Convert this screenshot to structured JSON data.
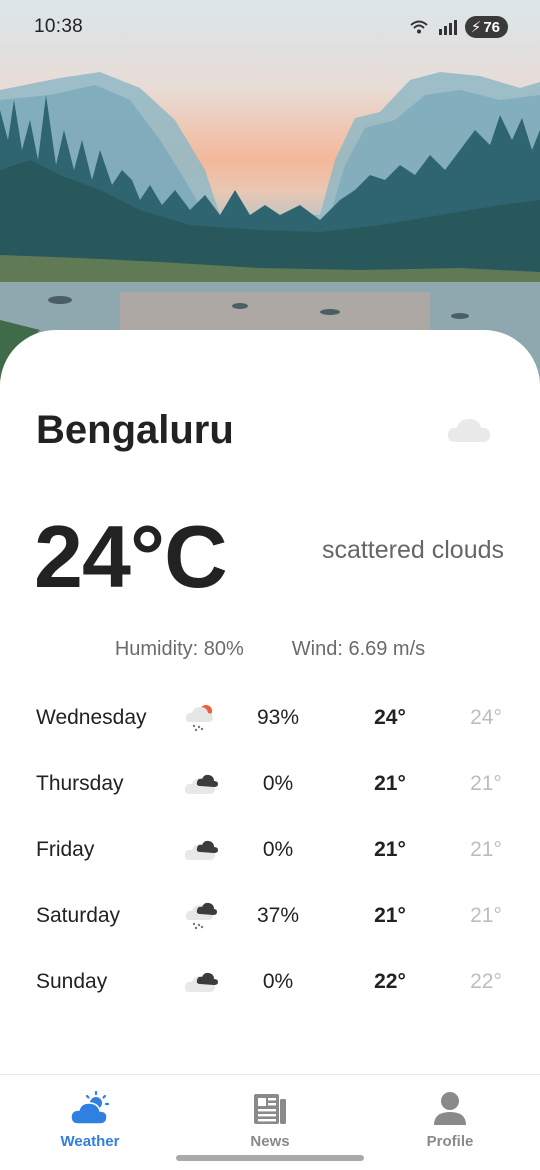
{
  "status_bar": {
    "time": "10:38",
    "battery": "76"
  },
  "weather": {
    "city": "Bengaluru",
    "header_icon": "cloud-icon",
    "temperature": "24°C",
    "description": "scattered clouds",
    "humidity": "Humidity: 80%",
    "wind": "Wind: 6.69 m/s"
  },
  "forecast": [
    {
      "day": "Wednesday",
      "icon": "rain-sun-icon",
      "pop": "93%",
      "high": "24°",
      "low": "24°"
    },
    {
      "day": "Thursday",
      "icon": "clouds-icon",
      "pop": "0%",
      "high": "21°",
      "low": "21°"
    },
    {
      "day": "Friday",
      "icon": "clouds-icon",
      "pop": "0%",
      "high": "21°",
      "low": "21°"
    },
    {
      "day": "Saturday",
      "icon": "rain-cloud-icon",
      "pop": "37%",
      "high": "21°",
      "low": "21°"
    },
    {
      "day": "Sunday",
      "icon": "clouds-icon",
      "pop": "0%",
      "high": "22°",
      "low": "22°"
    }
  ],
  "nav": {
    "items": [
      {
        "label": "Weather",
        "icon": "weather-icon",
        "active": true
      },
      {
        "label": "News",
        "icon": "news-icon",
        "active": false
      },
      {
        "label": "Profile",
        "icon": "profile-icon",
        "active": false
      }
    ]
  },
  "colors": {
    "accent": "#2f80e0",
    "muted": "#8a8a8a",
    "low_temp": "#bdbdbd"
  }
}
